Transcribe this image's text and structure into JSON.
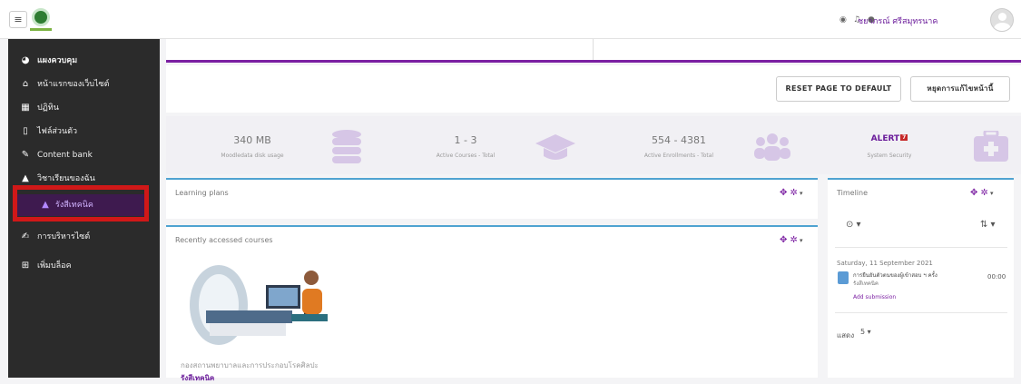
{
  "header": {
    "menu_icon": "hamburger-icon",
    "user_name": "ชยาภรณ์ ศรีสมุทรนาค",
    "icons": [
      "globe-icon",
      "bell-icon",
      "chat-icon"
    ]
  },
  "sidebar": {
    "items": [
      {
        "icon": "dashboard-icon",
        "label": "แผงควบคุม"
      },
      {
        "icon": "home-icon",
        "label": "หน้าแรกของเว็บไซต์"
      },
      {
        "icon": "calendar-icon",
        "label": "ปฏิทิน"
      },
      {
        "icon": "file-icon",
        "label": "ไฟล์ส่วนตัว"
      },
      {
        "icon": "pen-icon",
        "label": "Content bank"
      },
      {
        "icon": "graduation-cap-icon",
        "label": "วิชาเรียนของฉัน"
      },
      {
        "icon": "graduation-cap-icon",
        "label": "รังสีเทคนิค"
      },
      {
        "icon": "wrench-icon",
        "label": "การบริหารไซต์"
      },
      {
        "icon": "plus-box-icon",
        "label": "เพิ่มบล็อค"
      }
    ]
  },
  "toolbar": {
    "reset_label": "RESET PAGE TO DEFAULT",
    "stop_edit_label": "หยุดการแก้ไขหน้านี้"
  },
  "stats": [
    {
      "value": "340 MB",
      "label": "Moodledata disk usage",
      "icon": "database-icon"
    },
    {
      "value": "1 - 3",
      "label": "Active Courses - Total",
      "icon": "graduation-cap-icon"
    },
    {
      "value": "554 - 4381",
      "label": "Active Enrollments - Total",
      "icon": "users-icon"
    },
    {
      "value": "ALERT",
      "badge": "7",
      "label": "System Security",
      "icon": "first-aid-icon"
    }
  ],
  "blocks": {
    "learning_plans": {
      "title": "Learning plans"
    },
    "recent": {
      "title": "Recently accessed courses",
      "course_name": "กองสถานพยาบาลและการประกอบโรคศิลปะ",
      "course_category": "รังสีเทคนิค"
    },
    "timeline": {
      "title": "Timeline",
      "date": "Saturday, 11 September 2021",
      "event_title": "การยืนยันตัวตนของผู้เข้าสอบ ฯ ครั้ง",
      "event_course": "รังสีเทคนิค",
      "event_time": "00:00",
      "event_action": "Add submission",
      "show_label": "แสดง",
      "show_value": "5"
    }
  },
  "colors": {
    "accent": "#7b1fa2",
    "sidebar": "#2b2b2b",
    "highlight": "#d01818",
    "card_border": "#4fa3d1"
  }
}
